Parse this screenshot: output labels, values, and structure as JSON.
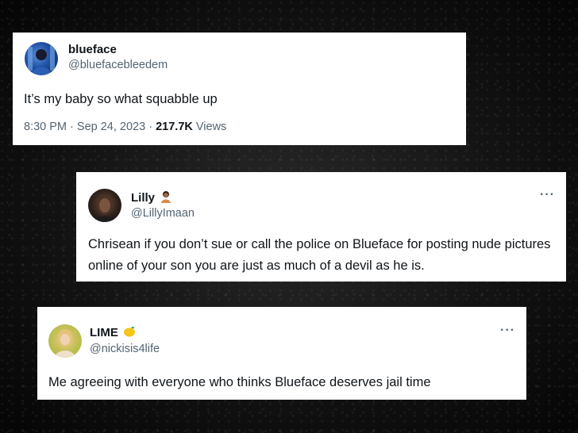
{
  "tweets": [
    {
      "name": "blueface",
      "handle": "@bluefacebleedem",
      "text": "It’s my baby so what squabble up",
      "time": "8:30 PM",
      "date": "Sep 24, 2023",
      "views_count": "217.7K",
      "views_label": "Views"
    },
    {
      "name": "Lilly",
      "handle": "@LillyImaan",
      "text": "Chrisean if you don’t sue or call the police on Blueface for posting nude pictures online of your son you are just as much of a devil as he is.",
      "more": "···"
    },
    {
      "name": "LIME",
      "handle": "@nickisis4life",
      "text": "Me agreeing with everyone who thinks Blueface deserves jail time",
      "more": "···"
    }
  ],
  "separator": "·",
  "icons": {
    "tweet1_avatar": "profile-photo",
    "tweet2_avatar": "profile-photo",
    "tweet2_name_emoji": "person-emoji",
    "tweet3_avatar": "profile-photo",
    "tweet3_name_emoji": "lemon-emoji"
  }
}
